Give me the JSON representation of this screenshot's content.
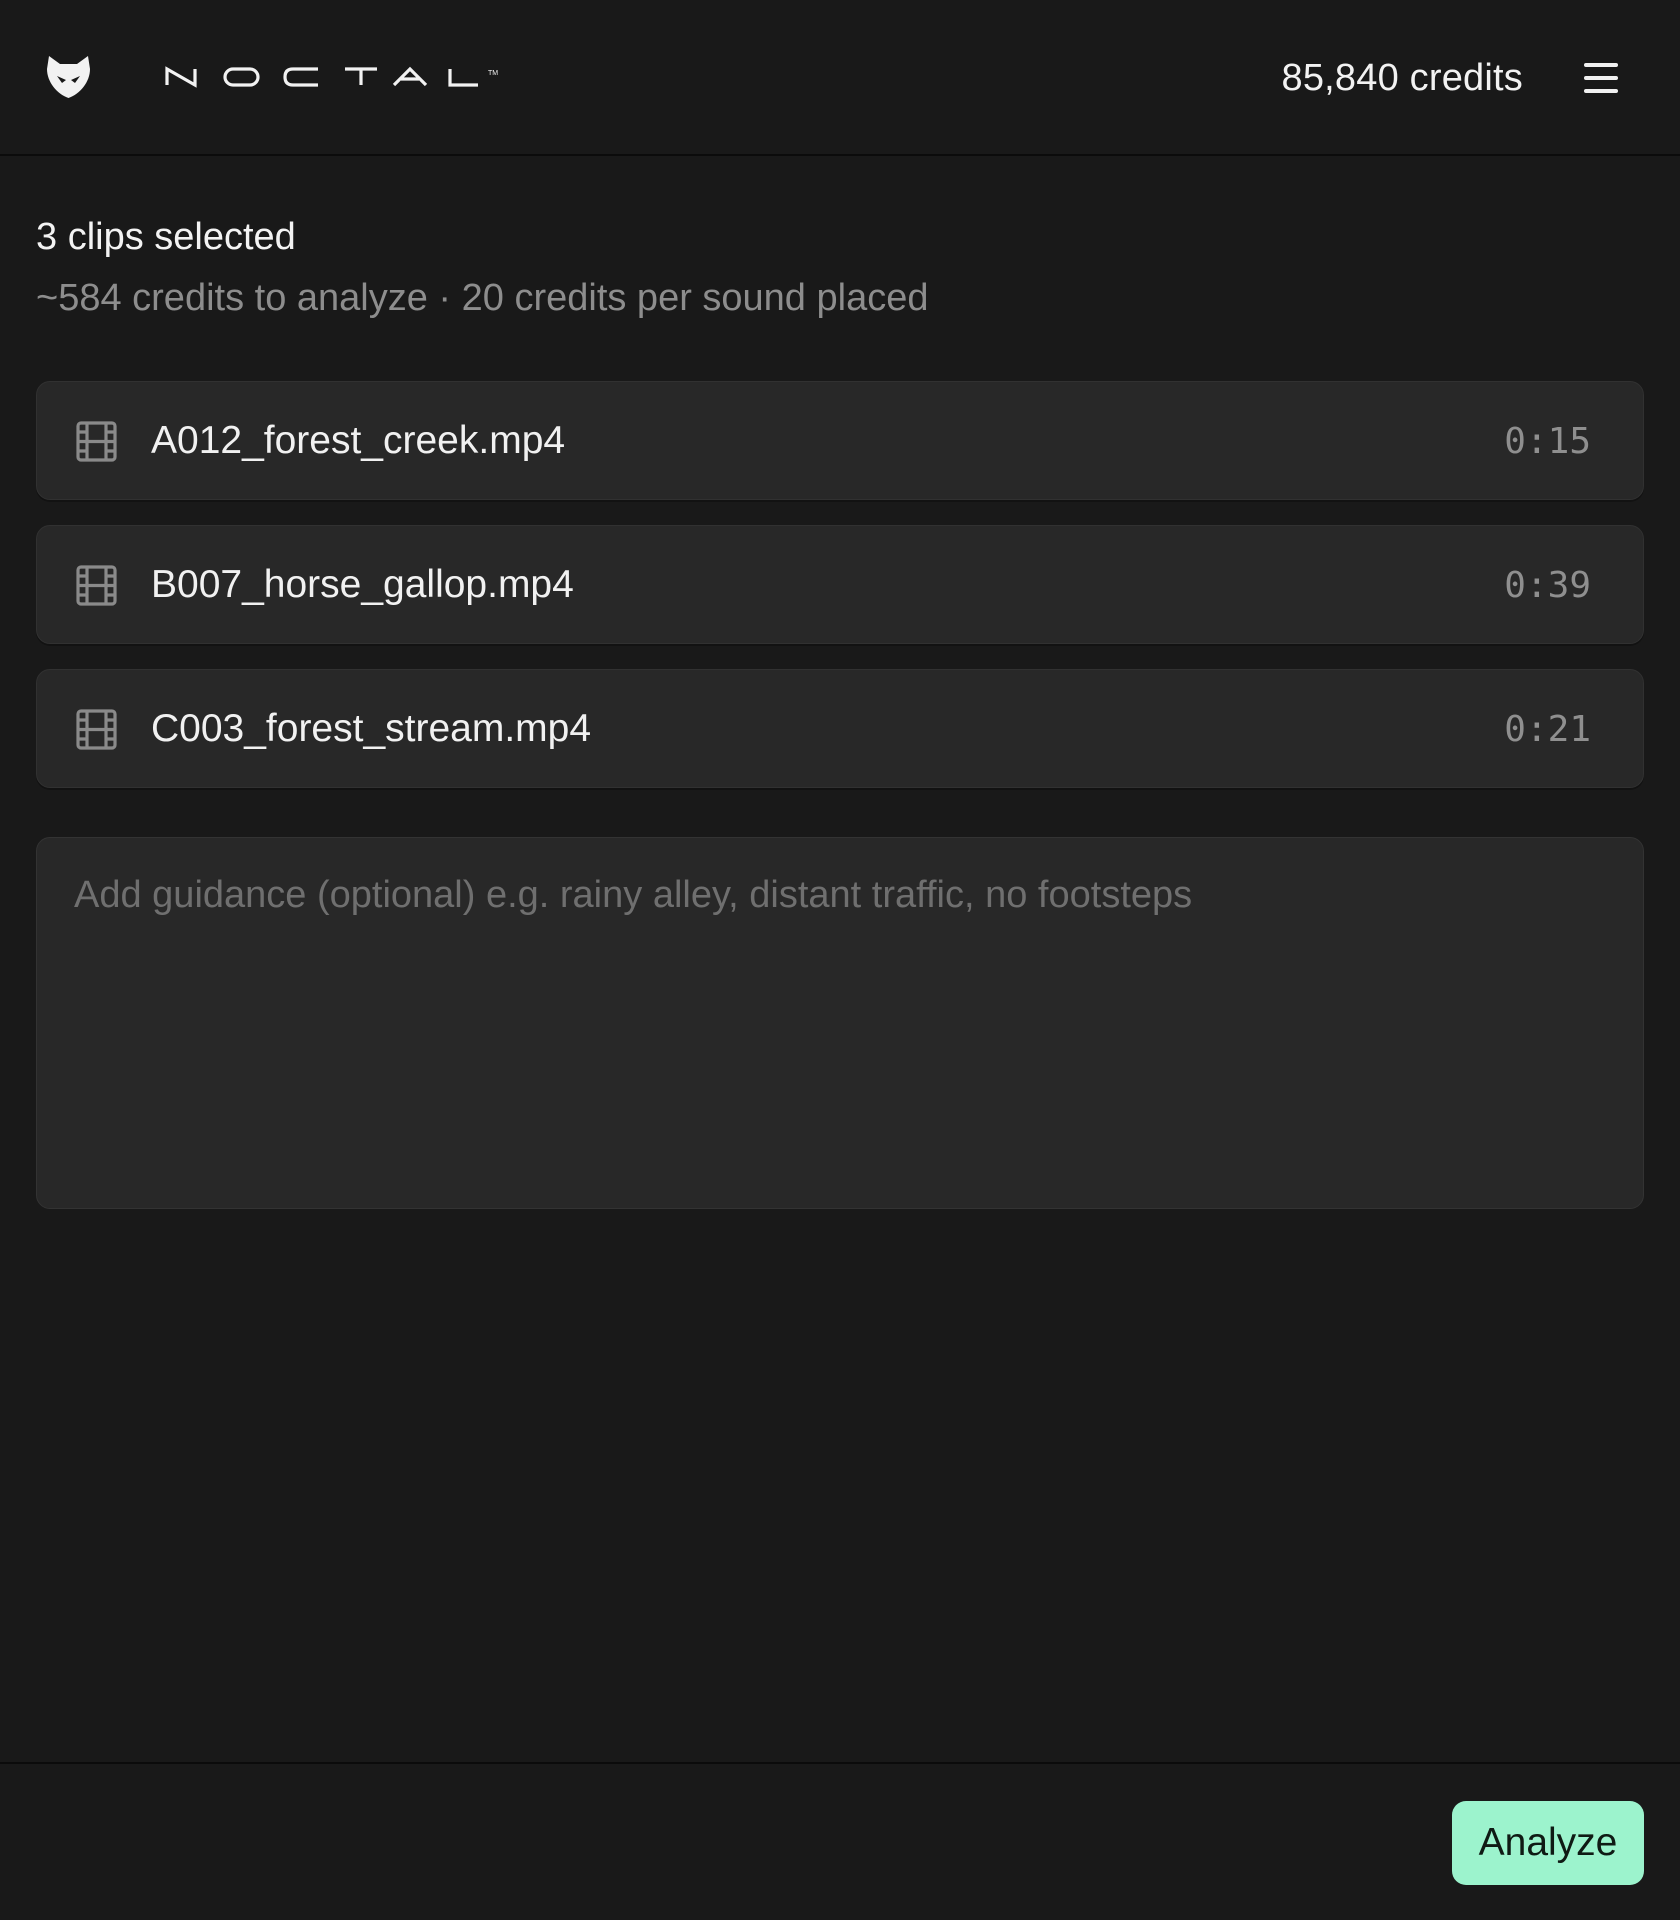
{
  "header": {
    "logo_icon": "fox-head-icon",
    "wordmark": "NOCTAL™",
    "credits": "85,840 credits",
    "menu_icon": "hamburger-menu-icon"
  },
  "summary": {
    "title": "3 clips selected",
    "subtitle": "~584 credits to analyze · 20 credits per sound placed"
  },
  "clips": [
    {
      "name": "A012_forest_creek.mp4",
      "duration": "0:15",
      "icon": "film-icon"
    },
    {
      "name": "B007_horse_gallop.mp4",
      "duration": "0:39",
      "icon": "film-icon"
    },
    {
      "name": "C003_forest_stream.mp4",
      "duration": "0:21",
      "icon": "film-icon"
    }
  ],
  "guidance": {
    "placeholder": "Add guidance (optional) e.g. rainy alley, distant traffic, no footsteps",
    "value": ""
  },
  "footer": {
    "analyze_label": "Analyze"
  },
  "colors": {
    "background": "#191919",
    "surface": "#282828",
    "accent": "#9cf3cd",
    "muted_text": "#8d8d8d"
  }
}
